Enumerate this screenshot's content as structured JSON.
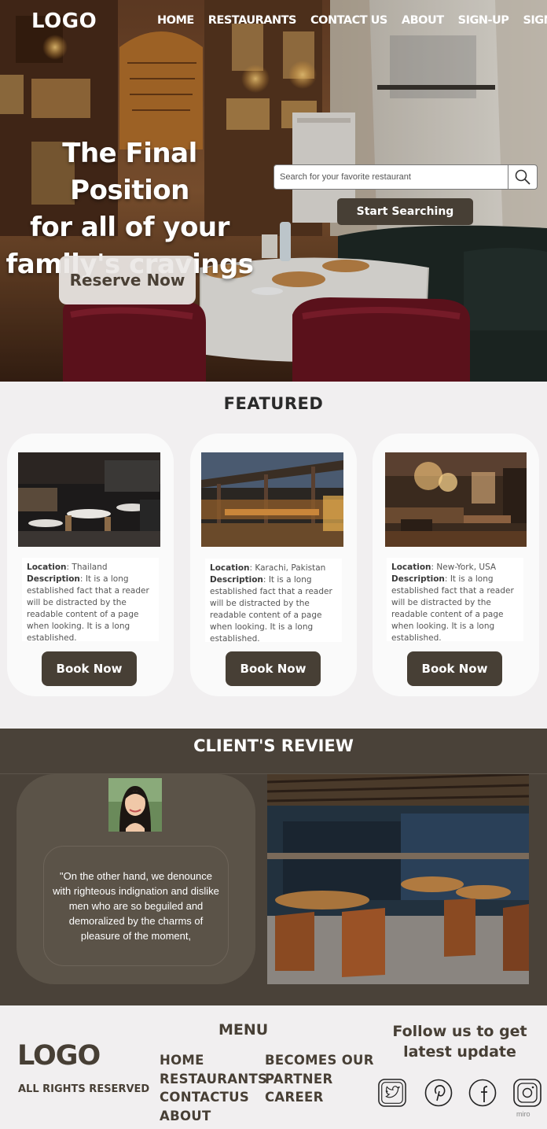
{
  "nav": {
    "logo": "LOGO",
    "links": [
      "HOME",
      "RESTAURANTS",
      "CONTACT US",
      "ABOUT",
      "SIGN-UP",
      "SIGN-IN"
    ]
  },
  "hero": {
    "title_lines": [
      "The Final Position",
      "for all of your",
      "family's cravings"
    ],
    "reserve_label": "Reserve Now",
    "search_placeholder": "Search for your favorite restaurant",
    "search_button": "Start Searching"
  },
  "featured": {
    "title": "FEATURED",
    "location_label": "Location",
    "description_label": "Description",
    "cards": [
      {
        "location": "Thailand",
        "description": "It is a long established fact that a reader will be distracted by the readable content of a page when looking. It is a long established.",
        "button": "Book Now"
      },
      {
        "location": "Karachi, Pakistan",
        "description": "It is a long established fact that a reader will be distracted by the readable content of a page when looking. It is a long established.",
        "button": "Book Now"
      },
      {
        "location": "New-York, USA",
        "description": "It is a long established fact that a reader will be distracted by the readable content of a page when looking. It is a long established.",
        "button": "Book Now"
      }
    ]
  },
  "review": {
    "title": "CLIENT'S REVIEW",
    "quote": "\"On the other hand, we denounce with righteous indignation and dislike men who are so beguiled and demoralized by the charms of pleasure of the moment,"
  },
  "footer": {
    "logo": "LOGO",
    "rights": "ALL RIGHTS RESERVED",
    "menu_title": "MENU",
    "menu_col1": [
      "HOME",
      "RESTAURANTS",
      "CONTACTUS",
      "ABOUT"
    ],
    "menu_col2": [
      "BECOMES OUR",
      "PARTNER",
      "CAREER"
    ],
    "follow": "Follow us to get latest update",
    "social": [
      "twitter-icon",
      "pinterest-icon",
      "facebook-icon",
      "instagram-icon"
    ],
    "watermark": "miro"
  },
  "colors": {
    "brand_dark": "#473f35",
    "review_bg": "#4a4239",
    "page_bg": "#f1eff0"
  }
}
